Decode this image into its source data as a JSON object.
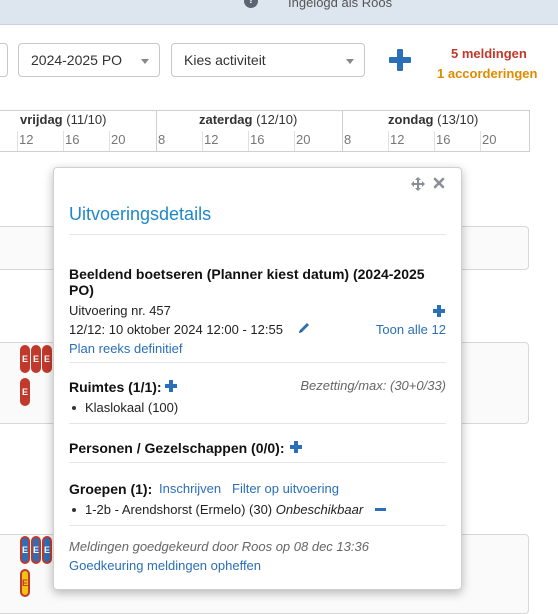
{
  "topbar": {
    "login_text": "Ingelogd als Roos"
  },
  "toolbar": {
    "year_select": "2024-2025 PO",
    "activity_select": "Kies activiteit",
    "notifications": "5 meldingen",
    "approvals": "1 accorderingen"
  },
  "calendar": {
    "days": [
      {
        "name": "vrijdag",
        "date": "(11/10)"
      },
      {
        "name": "zaterdag",
        "date": "(12/10)"
      },
      {
        "name": "zondag",
        "date": "(13/10)"
      }
    ],
    "ticks": [
      "12",
      "16",
      "20",
      "8",
      "12",
      "16",
      "20",
      "8",
      "12",
      "16",
      "20"
    ]
  },
  "badges": {
    "letter": "E"
  },
  "popup": {
    "title": "Uitvoeringsdetails",
    "activity_name": "Beeldend boetseren (Planner kiest datum) (2024-2025 PO)",
    "execution_nr": "Uitvoering nr. 457",
    "session": "12/12: 10 oktober 2024 12:00 - 12:55",
    "show_all": "Toon alle 12",
    "plan_series": "Plan reeks definitief",
    "rooms_heading": "Ruimtes (1/1):",
    "occupancy": "Bezetting/max: (30+0/33)",
    "room_item": "Klaslokaal (100)",
    "persons_heading": "Personen / Gezelschappen (0/0):",
    "groups_heading": "Groepen (1):",
    "enroll": "Inschrijven",
    "filter": "Filter op uitvoering",
    "group_item": "1-2b - Arendshorst (Ermelo) (30)",
    "group_status": "Onbeschikbaar",
    "approval_note": "Meldingen goedgekeurd door Roos op 08 dec 13:36",
    "revoke": "Goedkeuring meldingen opheffen"
  },
  "colors": {
    "accent": "#1e88c8",
    "link": "#2a6fb8",
    "notification_red": "#c0392b",
    "approval_orange": "#e08a00"
  }
}
